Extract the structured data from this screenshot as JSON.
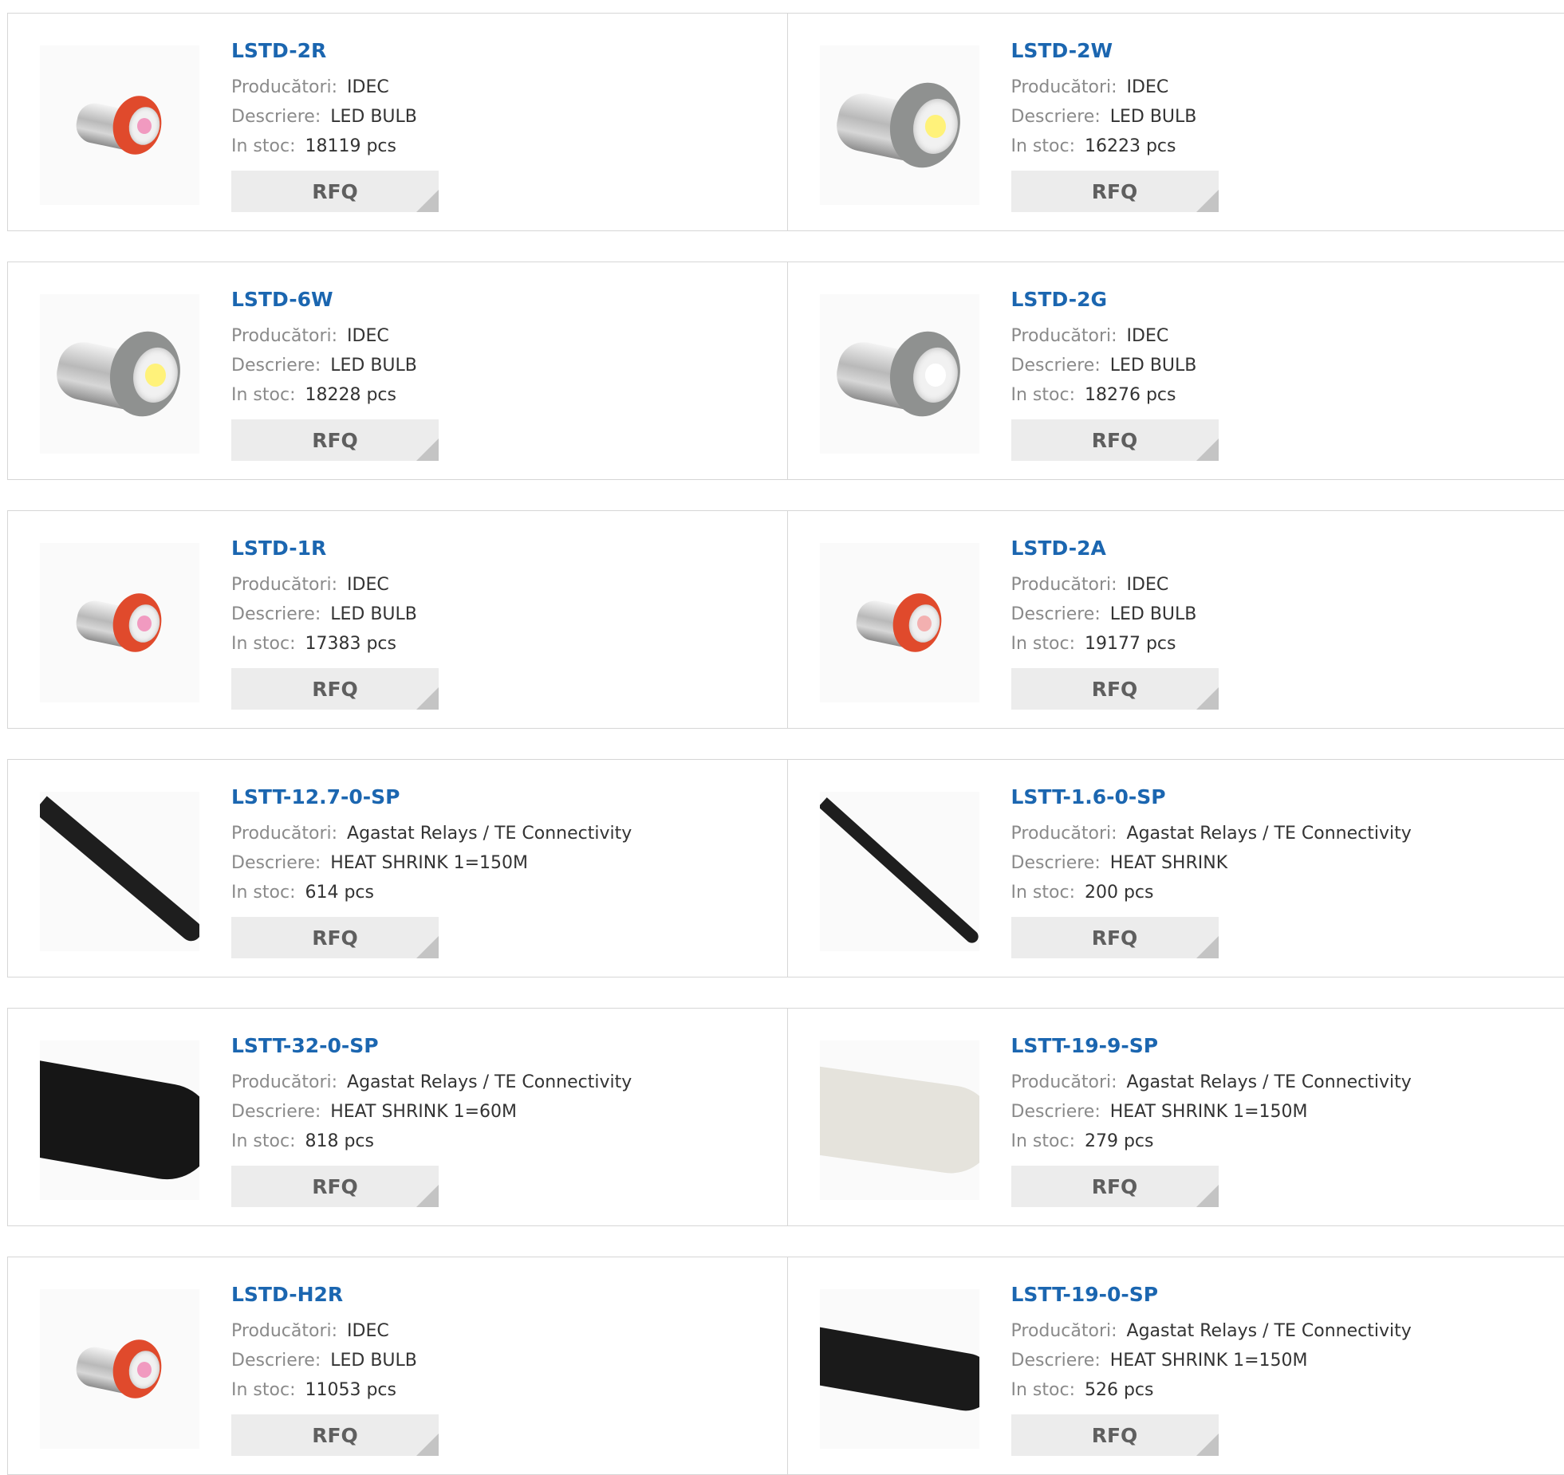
{
  "labels": {
    "manufacturer": "Producători:",
    "description": "Descriere:",
    "stock": "In stoc:",
    "rfq": "RFQ"
  },
  "colors": {
    "link": "#1b66b0",
    "label": "#8a8a8a",
    "value": "#333333",
    "rfq_bg": "#ececec",
    "border": "#d6d6d6"
  },
  "products": [
    {
      "part": "LSTD-2R",
      "manufacturer": "IDEC",
      "description": "LED BULB",
      "stock": "18119 pcs",
      "image": "led-bulb-red",
      "image_icon": "red-led-bulb-icon"
    },
    {
      "part": "LSTD-2W",
      "manufacturer": "IDEC",
      "description": "LED BULB",
      "stock": "16223 pcs",
      "image": "led-bulb-white",
      "image_icon": "white-led-bulb-icon"
    },
    {
      "part": "LSTD-6W",
      "manufacturer": "IDEC",
      "description": "LED BULB",
      "stock": "18228 pcs",
      "image": "led-bulb-white",
      "image_icon": "white-led-bulb-icon"
    },
    {
      "part": "LSTD-2G",
      "manufacturer": "IDEC",
      "description": "LED BULB",
      "stock": "18276 pcs",
      "image": "led-bulb-green",
      "image_icon": "green-led-bulb-icon"
    },
    {
      "part": "LSTD-1R",
      "manufacturer": "IDEC",
      "description": "LED BULB",
      "stock": "17383 pcs",
      "image": "led-bulb-red",
      "image_icon": "red-led-bulb-icon"
    },
    {
      "part": "LSTD-2A",
      "manufacturer": "IDEC",
      "description": "LED BULB",
      "stock": "19177 pcs",
      "image": "led-bulb-amber",
      "image_icon": "amber-led-bulb-icon"
    },
    {
      "part": "LSTT-12.7-0-SP",
      "manufacturer": "Agastat Relays / TE Connectivity",
      "description": "HEAT SHRINK 1=150M",
      "stock": "614 pcs",
      "image": "tube-black-thin",
      "image_icon": "black-heat-shrink-tube-icon"
    },
    {
      "part": "LSTT-1.6-0-SP",
      "manufacturer": "Agastat Relays / TE Connectivity",
      "description": "HEAT SHRINK",
      "stock": "200 pcs",
      "image": "tube-black-thinner",
      "image_icon": "black-heat-shrink-tube-icon"
    },
    {
      "part": "LSTT-32-0-SP",
      "manufacturer": "Agastat Relays / TE Connectivity",
      "description": "HEAT SHRINK 1=60M",
      "stock": "818 pcs",
      "image": "tube-black-wide",
      "image_icon": "black-heat-shrink-tube-icon"
    },
    {
      "part": "LSTT-19-9-SP",
      "manufacturer": "Agastat Relays / TE Connectivity",
      "description": "HEAT SHRINK 1=150M",
      "stock": "279 pcs",
      "image": "tube-white-wide",
      "image_icon": "white-heat-shrink-tube-icon"
    },
    {
      "part": "LSTD-H2R",
      "manufacturer": "IDEC",
      "description": "LED BULB",
      "stock": "11053 pcs",
      "image": "led-bulb-red",
      "image_icon": "red-led-bulb-icon"
    },
    {
      "part": "LSTT-19-0-SP",
      "manufacturer": "Agastat Relays / TE Connectivity",
      "description": "HEAT SHRINK 1=150M",
      "stock": "526 pcs",
      "image": "tube-black-medium",
      "image_icon": "black-heat-shrink-tube-icon"
    }
  ]
}
